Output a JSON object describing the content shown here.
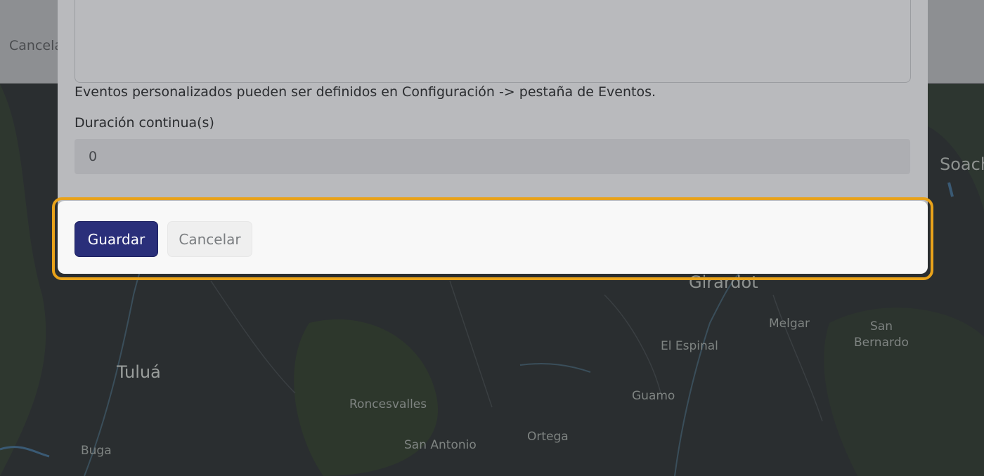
{
  "header": {
    "cancel_text": "Cancelar"
  },
  "modal": {
    "helper_text": "Eventos personalizados pueden ser definidos en Configuración -> pestaña de Eventos.",
    "duration": {
      "label": "Duración continua(s)",
      "value": "0"
    },
    "footer": {
      "save_label": "Guardar",
      "cancel_label": "Cancelar"
    }
  },
  "map": {
    "labels": [
      "Soach",
      "Girardot",
      "Melgar",
      "San",
      "Bernardo",
      "El Espinal",
      "Tuluá",
      "Guamo",
      "Roncesvalles",
      "Ortega",
      "San Antonio",
      "Buga"
    ]
  },
  "colors": {
    "accent": "#2a2f7a",
    "highlight": "#e8a21a"
  }
}
